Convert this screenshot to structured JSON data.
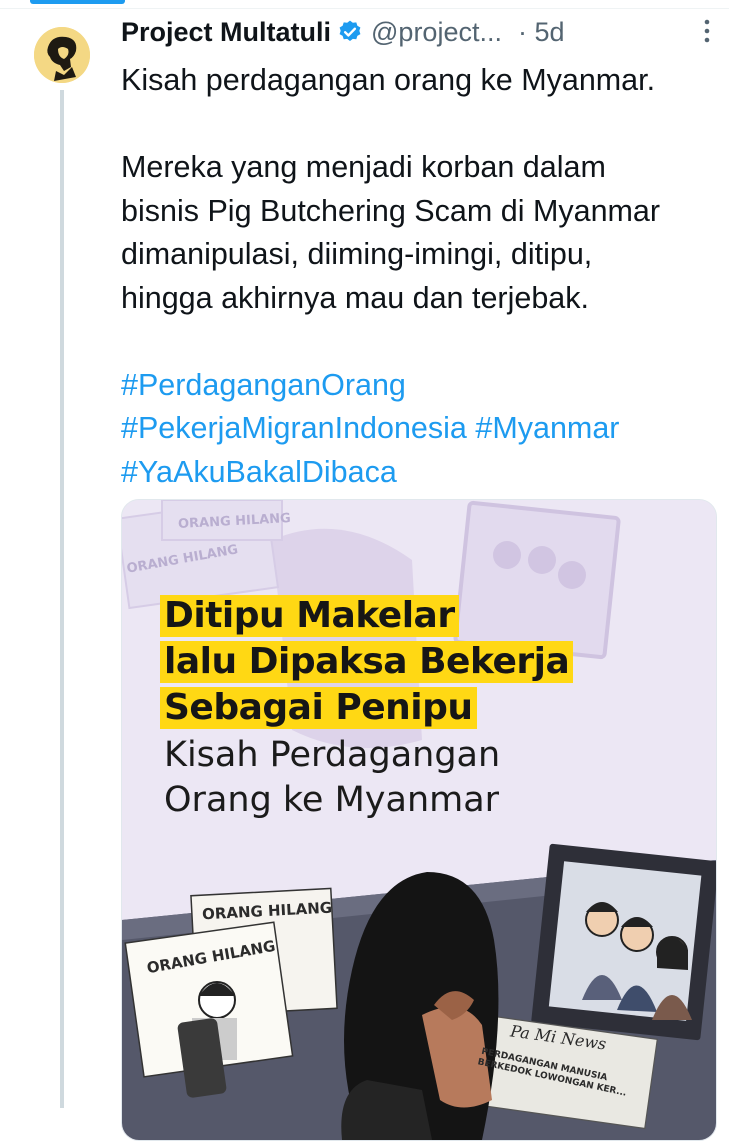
{
  "author": {
    "name": "Project Multatuli",
    "handle": "@project...",
    "time": "· 5d"
  },
  "tweet": {
    "line1": "Kisah perdagangan orang ke Myanmar.",
    "para2": [
      "Mereka yang menjadi korban dalam",
      "bisnis Pig Butchering Scam di Myanmar",
      "dimanipulasi, diiming-imingi, ditipu,",
      "hingga akhirnya mau dan terjebak."
    ],
    "hashtags_line1": "#PerdaganganOrang",
    "hashtags_line2a": "#PekerjaMigranIndonesia",
    "hashtags_line2b": "#Myanmar",
    "hashtags_line3": "#YaAkuBakalDibaca"
  },
  "media": {
    "headline": [
      "Ditipu Makelar",
      "lalu Dipaksa Bekerja",
      "Sebagai Penipu"
    ],
    "subheadline": [
      "Kisah Perdagangan",
      "Orang ke Myanmar"
    ],
    "poster_text": "ORANG HILANG",
    "newspaper_title": "Pa Mi News",
    "newspaper_headline": [
      "PERDAGANGAN MANUSIA",
      "BERKEDOK LOWONGAN KER..."
    ]
  },
  "colors": {
    "accent": "#1d9bf0",
    "highlight": "#ffd814",
    "media_bg": "#ece7f4"
  },
  "icons": {
    "verified": "verified-badge-icon",
    "more": "more-options-icon"
  }
}
